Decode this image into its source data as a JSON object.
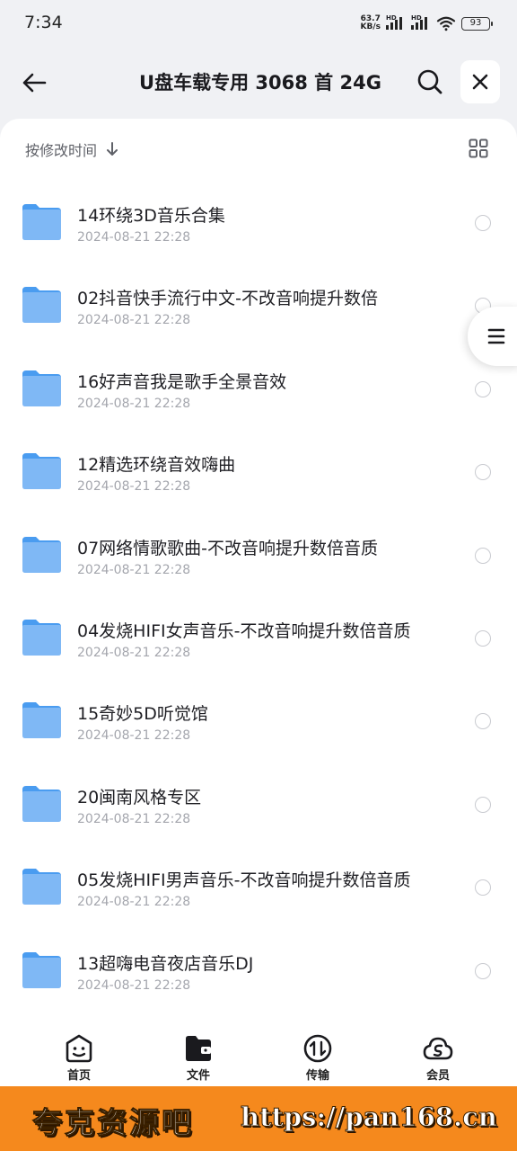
{
  "status_bar": {
    "time": "7:34",
    "net_speed_value": "63.7",
    "net_speed_unit": "KB/s",
    "signal_tag_1": "HD",
    "signal_tag_2": "HD",
    "battery": "93"
  },
  "header": {
    "title": "U盘车载专用 3068 首 24G",
    "icons": {
      "back": "arrow-left-icon",
      "search": "search-icon",
      "close": "close-icon"
    }
  },
  "sort": {
    "label": "按修改时间",
    "direction_icon": "arrow-down-icon",
    "view_icon": "grid-view-icon"
  },
  "files": [
    {
      "name": "14环绕3D音乐合集",
      "date": "2024-08-21 22:28"
    },
    {
      "name": "02抖音快手流行中文-不改音响提升数倍",
      "date": "2024-08-21 22:28"
    },
    {
      "name": "16好声音我是歌手全景音效",
      "date": "2024-08-21 22:28"
    },
    {
      "name": "12精选环绕音效嗨曲",
      "date": "2024-08-21 22:28"
    },
    {
      "name": "07网络情歌歌曲-不改音响提升数倍音质",
      "date": "2024-08-21 22:28"
    },
    {
      "name": "04发烧HIFI女声音乐-不改音响提升数倍音质",
      "date": "2024-08-21 22:28"
    },
    {
      "name": "15奇妙5D听觉馆",
      "date": "2024-08-21 22:28"
    },
    {
      "name": "20闽南风格专区",
      "date": "2024-08-21 22:28"
    },
    {
      "name": "05发烧HIFI男声音乐-不改音响提升数倍音质",
      "date": "2024-08-21 22:28"
    },
    {
      "name": "13超嗨电音夜店音乐DJ",
      "date": "2024-08-21 22:28"
    }
  ],
  "bottom_nav": [
    {
      "label": "首页",
      "icon": "home-face-icon",
      "active": false
    },
    {
      "label": "文件",
      "icon": "folder-wallet-icon",
      "active": true
    },
    {
      "label": "传输",
      "icon": "transfer-icon",
      "active": false
    },
    {
      "label": "会员",
      "icon": "cloud-vip-icon",
      "active": false
    }
  ],
  "banner": {
    "left_text": "夸克资源吧",
    "right_text": "https://pan168.cn"
  },
  "colors": {
    "folder": "#7fb8f5",
    "banner": "#f5891d",
    "background": "#f0f1f4"
  }
}
